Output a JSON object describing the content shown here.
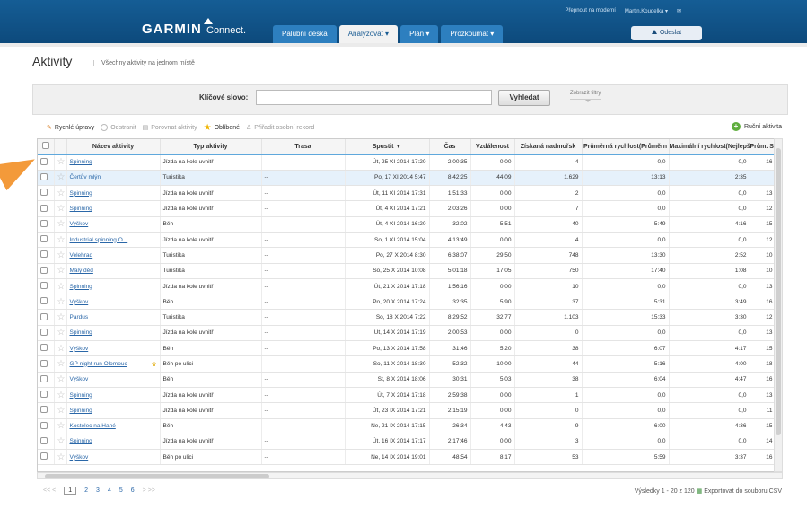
{
  "header": {
    "top_links": [
      "Přepnout na moderní",
      "Martin.Koudelka ▾"
    ],
    "logo": "GARMIN",
    "logo_sub": "Connect.",
    "nav": [
      "Palubní deska",
      "Analyzovat ▾",
      "Plán ▾",
      "Prozkoumat ▾"
    ],
    "upload_label": "Odeslat"
  },
  "page": {
    "title": "Aktivity",
    "subtitle": "Všechny aktivity na jednom místě"
  },
  "search": {
    "label": "Klíčové slovo:",
    "button": "Vyhledat",
    "filters": "Zobrazit filtry"
  },
  "toolbar": {
    "quick_edit": "Rychlé úpravy",
    "remove": "Odstranit",
    "compare": "Porovnat aktivity",
    "favorites": "Oblíbené",
    "assign_record": "Přiřadit osobní rekord",
    "manual": "Ruční aktivita"
  },
  "table": {
    "columns": [
      "Název aktivity",
      "Typ aktivity",
      "Trasa",
      "Spustit ▼",
      "Čas",
      "Vzdálenost",
      "Získaná nadmořsk",
      "Průměrná rychlost(Průměrn",
      "Maximální rychlost(Nejlepší",
      "Prům. ST"
    ],
    "rows": [
      [
        "Spinning",
        "Jízda na kole uvnitř",
        "--",
        "Út, 25 XI 2014 17:20",
        "2:00:35",
        "0,00",
        "4",
        "0,0",
        "0,0",
        "16"
      ],
      [
        "Čertův mlýn",
        "Turistika",
        "--",
        "Po, 17 XI 2014 5:47",
        "8:42:25",
        "44,09",
        "1.629",
        "13:13",
        "2:35",
        ""
      ],
      [
        "Spinning",
        "Jízda na kole uvnitř",
        "--",
        "Út, 11 XI 2014 17:31",
        "1:51:33",
        "0,00",
        "2",
        "0,0",
        "0,0",
        "13"
      ],
      [
        "Spinning",
        "Jízda na kole uvnitř",
        "--",
        "Út, 4 XI 2014 17:21",
        "2:03:26",
        "0,00",
        "7",
        "0,0",
        "0,0",
        "12"
      ],
      [
        "Vyškov",
        "Běh",
        "--",
        "Út, 4 XI 2014 16:20",
        "32:02",
        "5,51",
        "40",
        "5:49",
        "4:16",
        "15"
      ],
      [
        "Industrial spinning O...",
        "Jízda na kole uvnitř",
        "--",
        "So, 1 XI 2014 15:04",
        "4:13:49",
        "0,00",
        "4",
        "0,0",
        "0,0",
        "12"
      ],
      [
        "Velehrad",
        "Turistika",
        "--",
        "Po, 27 X 2014 8:30",
        "6:38:07",
        "29,50",
        "748",
        "13:30",
        "2:52",
        "10"
      ],
      [
        "Malý děd",
        "Turistika",
        "--",
        "So, 25 X 2014 10:08",
        "5:01:18",
        "17,05",
        "750",
        "17:40",
        "1:08",
        "10"
      ],
      [
        "Spinning",
        "Jízda na kole uvnitř",
        "--",
        "Út, 21 X 2014 17:18",
        "1:56:16",
        "0,00",
        "10",
        "0,0",
        "0,0",
        "13"
      ],
      [
        "Vyškov",
        "Běh",
        "--",
        "Po, 20 X 2014 17:24",
        "32:35",
        "5,90",
        "37",
        "5:31",
        "3:49",
        "16"
      ],
      [
        "Pardus",
        "Turistika",
        "--",
        "So, 18 X 2014 7:22",
        "8:29:52",
        "32,77",
        "1.103",
        "15:33",
        "3:30",
        "12"
      ],
      [
        "Spinning",
        "Jízda na kole uvnitř",
        "--",
        "Út, 14 X 2014 17:19",
        "2:00:53",
        "0,00",
        "0",
        "0,0",
        "0,0",
        "13"
      ],
      [
        "Vyškov",
        "Běh",
        "--",
        "Po, 13 X 2014 17:58",
        "31:46",
        "5,20",
        "38",
        "6:07",
        "4:17",
        "15"
      ],
      [
        "GP night run Olomouc",
        "Běh po ulici",
        "--",
        "So, 11 X 2014 18:30",
        "52:32",
        "10,00",
        "44",
        "5:16",
        "4:00",
        "18"
      ],
      [
        "Vyškov",
        "Běh",
        "--",
        "St, 8 X 2014 18:06",
        "30:31",
        "5,03",
        "38",
        "6:04",
        "4:47",
        "16"
      ],
      [
        "Spinning",
        "Jízda na kole uvnitř",
        "--",
        "Út, 7 X 2014 17:18",
        "2:59:38",
        "0,00",
        "1",
        "0,0",
        "0,0",
        "13"
      ],
      [
        "Spinning",
        "Jízda na kole uvnitř",
        "--",
        "Út, 23 IX 2014 17:21",
        "2:15:19",
        "0,00",
        "0",
        "0,0",
        "0,0",
        "11"
      ],
      [
        "Kostelec na Hané",
        "Běh",
        "--",
        "Ne, 21 IX 2014 17:15",
        "26:34",
        "4,43",
        "9",
        "6:00",
        "4:36",
        "15"
      ],
      [
        "Spinning",
        "Jízda na kole uvnitř",
        "--",
        "Út, 16 IX 2014 17:17",
        "2:17:46",
        "0,00",
        "3",
        "0,0",
        "0,0",
        "14"
      ],
      [
        "Vyškov",
        "Běh po ulici",
        "--",
        "Ne, 14 IX 2014 19:01",
        "48:54",
        "8,17",
        "53",
        "5:59",
        "3:37",
        "16"
      ]
    ]
  },
  "pager": {
    "pages": [
      "1",
      "2",
      "3",
      "4",
      "5",
      "6"
    ],
    "prev": "<<  <",
    "next": ">  >>"
  },
  "footer": {
    "results": "Výsledky 1 - 20 z 120",
    "export": "Exportovat do souboru CSV"
  }
}
